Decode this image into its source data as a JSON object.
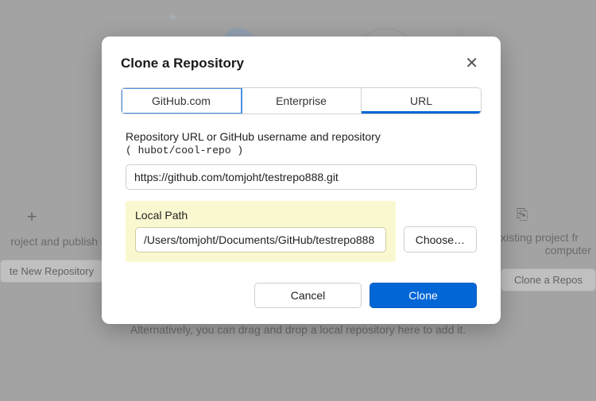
{
  "modal": {
    "title": "Clone a Repository",
    "tabs": {
      "github": "GitHub.com",
      "enterprise": "Enterprise",
      "url": "URL"
    },
    "repo_label_prefix": "Repository URL or GitHub username and repository",
    "repo_label_example": "( hubot/cool-repo )",
    "repo_url_value": "https://github.com/tomjoht/testrepo888.git",
    "local_path_label": "Local Path",
    "local_path_value": "/Users/tomjoht/Documents/GitHub/testrepo888",
    "choose_label": "Choose…",
    "cancel_label": "Cancel",
    "clone_label": "Clone"
  },
  "background": {
    "left_card_plus": "+",
    "left_card_text": "roject and publish i",
    "left_card_button": "te New Repository",
    "right_card_text": "xisting project fr",
    "right_card_text2": "computer",
    "right_card_button": "Clone a Repos",
    "footer_text": "Alternatively, you can drag and drop a local repository here to add it."
  }
}
